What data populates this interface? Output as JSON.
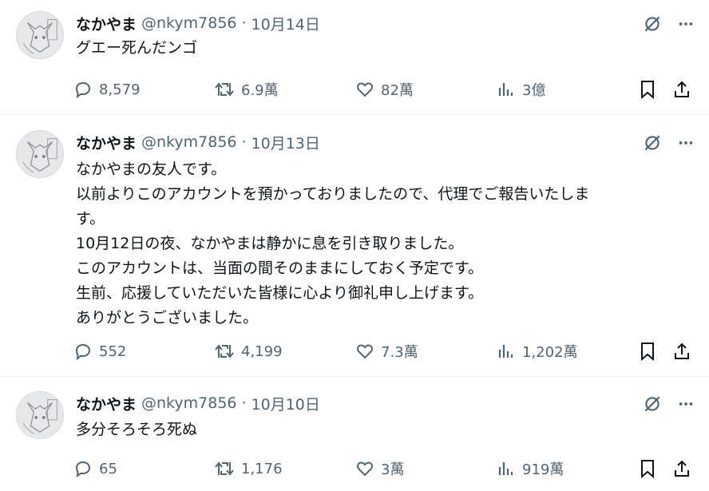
{
  "tweets": [
    {
      "name": "なかやま",
      "handle": "@nkym7856",
      "sep": "·",
      "date": "10月14日",
      "lines": [
        "グエー死んだンゴ"
      ],
      "replies": "8,579",
      "retweets": "6.9萬",
      "likes": "82萬",
      "views": "3億"
    },
    {
      "name": "なかやま",
      "handle": "@nkym7856",
      "sep": "·",
      "date": "10月13日",
      "lines": [
        "なかやまの友人です。",
        "以前よりこのアカウントを預かっておりましたので、代理でご報告いたしま",
        "す。",
        "10月12日の夜、なかやまは静かに息を引き取りました。",
        "このアカウントは、当面の間そのままにしておく予定です。",
        "生前、応援していただいた皆様に心より御礼申し上げます。",
        "ありがとうございました。"
      ],
      "replies": "552",
      "retweets": "4,199",
      "likes": "7.3萬",
      "views": "1,202萬"
    },
    {
      "name": "なかやま",
      "handle": "@nkym7856",
      "sep": "·",
      "date": "10月10日",
      "lines": [
        "多分そろそろ死ぬ"
      ],
      "replies": "65",
      "retweets": "1,176",
      "likes": "3萬",
      "views": "919萬"
    }
  ],
  "icons": {
    "grok": "grok-icon",
    "more": "more-icon",
    "reply": "reply-icon",
    "retweet": "retweet-icon",
    "like": "like-icon",
    "views": "views-icon",
    "bookmark": "bookmark-icon",
    "share": "share-icon"
  },
  "colors": {
    "text": "#0f1419",
    "muted": "#536471",
    "divider": "#eff3f4"
  }
}
